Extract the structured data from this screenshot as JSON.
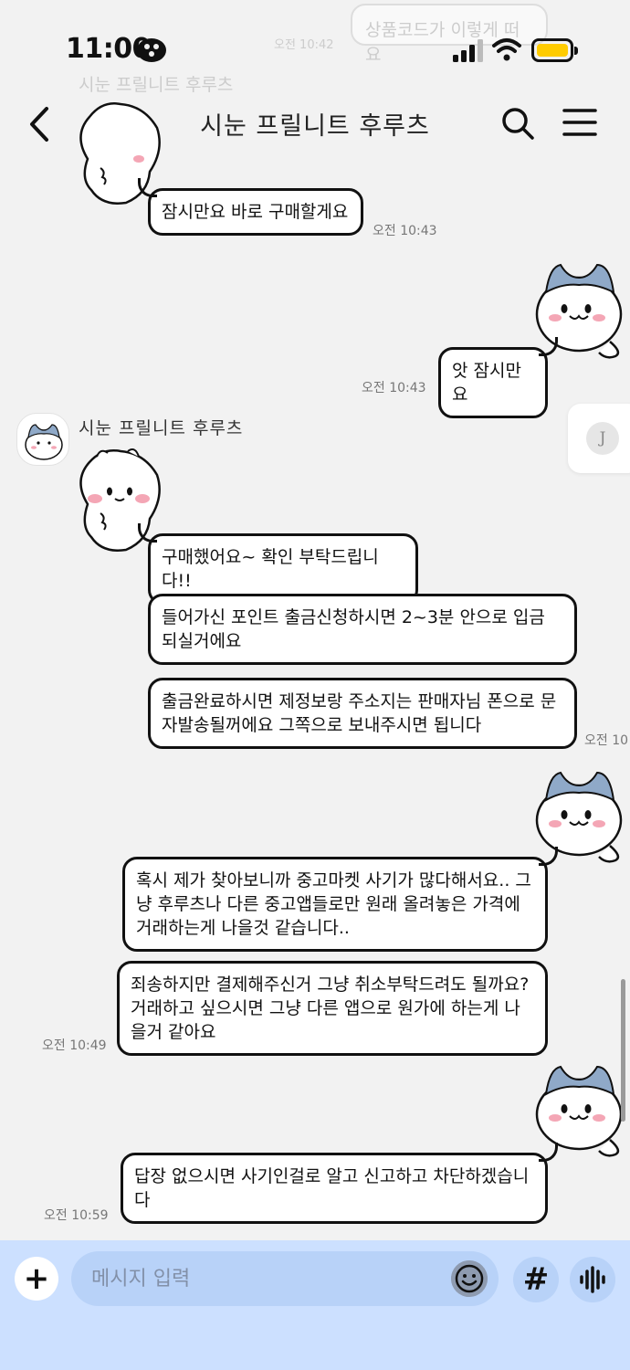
{
  "status_bar": {
    "time": "11:00"
  },
  "ghost": {
    "bubble_text": "상품코드가 이렇게 떠요",
    "time": "오전 10:42",
    "name": "시눈 프릴니트 후루츠"
  },
  "header": {
    "title": "시눈 프릴니트 후루츠"
  },
  "messages": [
    {
      "side": "left",
      "text": "잠시만요 바로 구매할게요",
      "time": "오전 10:43"
    },
    {
      "side": "right",
      "text": "앗 잠시만요",
      "time": "오전 10:43"
    },
    {
      "side": "left",
      "text": "구매했어요~ 확인 부탁드립니다!!"
    },
    {
      "side": "left",
      "text": "들어가신 포인트 출금신청하시면 2~3분 안으로 입금 되실거에요"
    },
    {
      "side": "left",
      "text": "출금완료하시면 제정보랑 주소지는 판매자님 폰으로 문자발송될꺼에요 그쪽으로 보내주시면 됩니다",
      "time": "오전 10"
    },
    {
      "side": "right",
      "text": "혹시 제가 찾아보니까 중고마켓 사기가 많다해서요.. 그냥 후루츠나 다른 중고앱들로만 원래 올려놓은 가격에 거래하는게 나을것 같습니다.."
    },
    {
      "side": "right",
      "text": "죄송하지만 결제해주신거 그냥 취소부탁드려도 될까요? 거래하고 싶으시면 그냥 다른 앱으로 원가에 하는게 나을거 같아요",
      "time": "오전 10:49"
    },
    {
      "side": "right",
      "text": "답장 없으시면 사기인걸로 알고 신고하고 차단하겠습니다",
      "time": "오전 10:59"
    }
  ],
  "sender": {
    "name": "시눈 프릴니트 후루츠"
  },
  "side_chip": {
    "initial": "J"
  },
  "input": {
    "placeholder": "메시지 입력",
    "plus": "+",
    "hash": "#"
  },
  "colors": {
    "input_bar": "#cce0ff",
    "battery": "#ffcc00",
    "cat_ears": "#8fa9c8"
  }
}
